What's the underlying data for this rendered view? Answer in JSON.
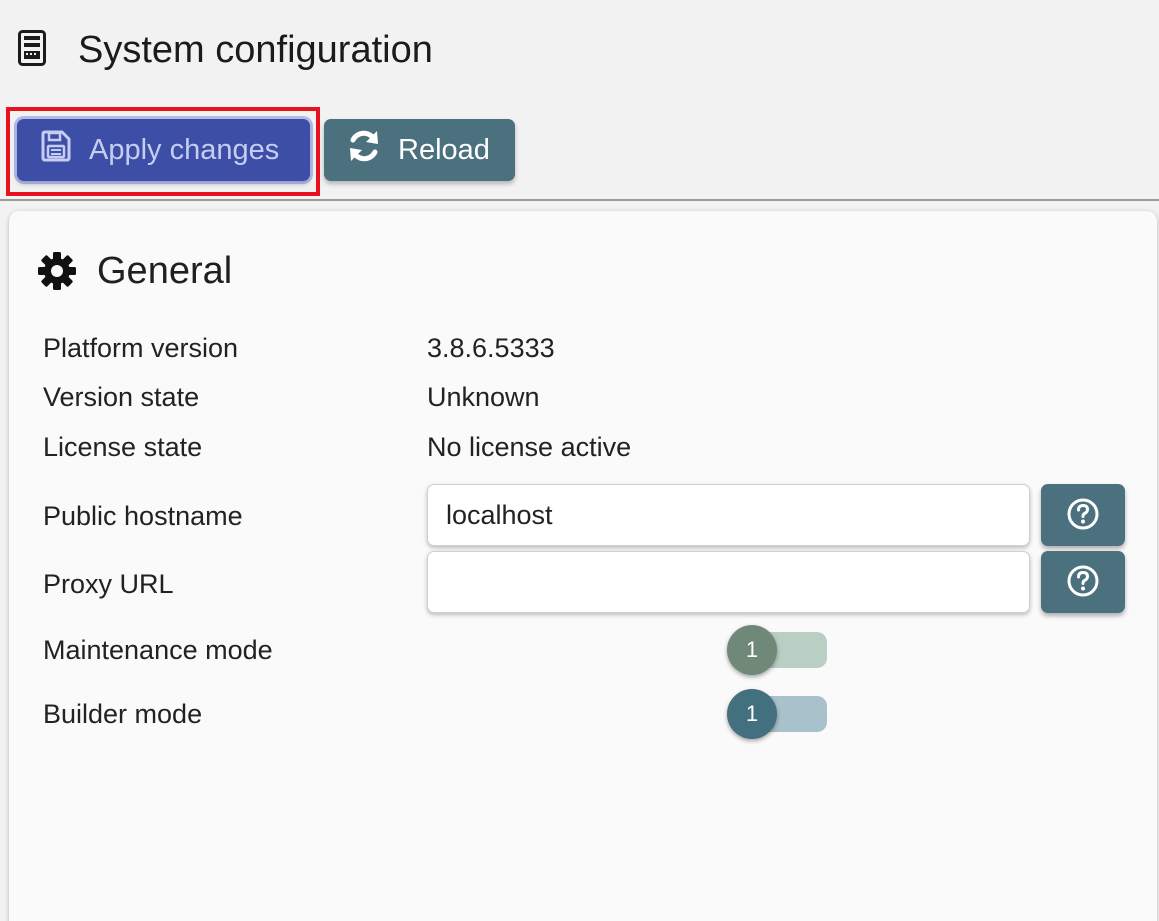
{
  "page": {
    "title": "System configuration",
    "icon": "server-icon"
  },
  "toolbar": {
    "apply_label": "Apply changes",
    "apply_icon": "floppy-disk-icon",
    "reload_label": "Reload",
    "reload_icon": "sync-icon"
  },
  "general": {
    "title": "General",
    "icon": "gear-icon",
    "platform_version": {
      "label": "Platform version",
      "value": "3.8.6.5333"
    },
    "version_state": {
      "label": "Version state",
      "value": "Unknown"
    },
    "license_state": {
      "label": "License state",
      "value": "No license active"
    },
    "public_hostname": {
      "label": "Public hostname",
      "value": "localhost",
      "help_icon": "question-circle-icon"
    },
    "proxy_url": {
      "label": "Proxy URL",
      "value": "",
      "help_icon": "question-circle-icon"
    },
    "maintenance_mode": {
      "label": "Maintenance mode",
      "toggle_value": "1"
    },
    "builder_mode": {
      "label": "Builder mode",
      "toggle_value": "1"
    }
  },
  "colors": {
    "apply_button": "#3d4ea6",
    "secondary_button": "#4a717d",
    "highlight_border": "#e8121f",
    "maintenance_knob": "#6f8878",
    "maintenance_track": "#b9cfc4",
    "builder_knob": "#43707f",
    "builder_track": "#a9c1ca"
  }
}
